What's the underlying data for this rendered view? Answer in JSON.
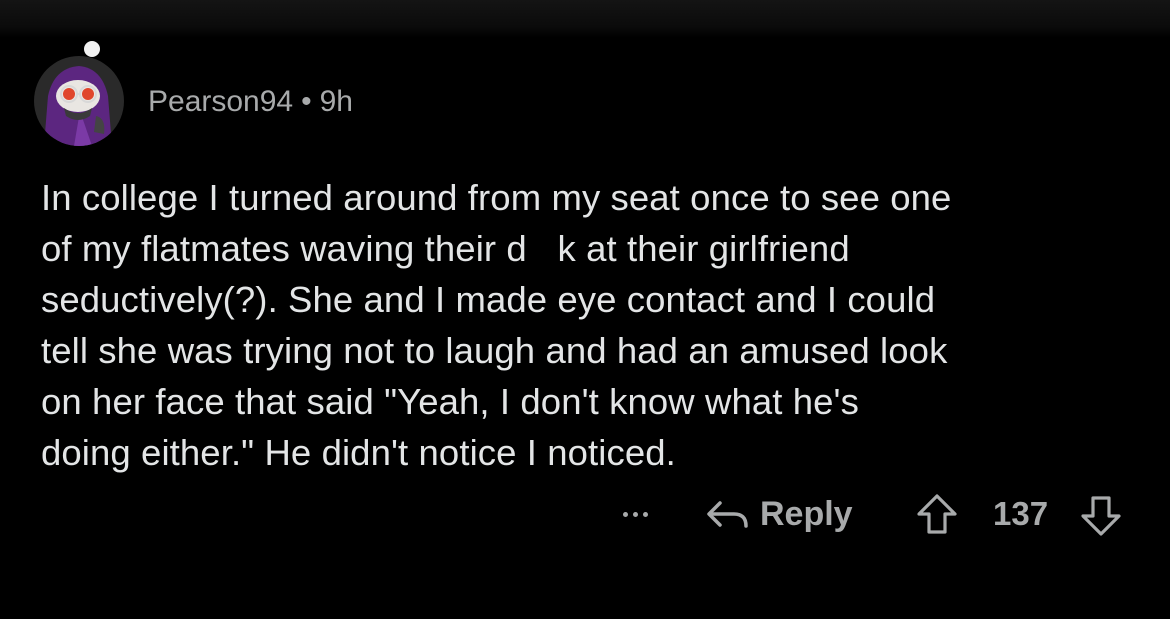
{
  "comment": {
    "author": "Pearson94",
    "separator": "•",
    "age": "9h",
    "body_lines": [
      "In college I turned around from my seat once to see one",
      "of my flatmates waving their d   k at their girlfriend",
      "seductively(?). She and I made eye contact and I could",
      "tell she was trying not to laugh and had an amused look",
      "on her face that said \"Yeah, I don't know what he's",
      "doing either.\" He didn't notice I noticed."
    ]
  },
  "actions": {
    "more_icon": "ellipsis-icon",
    "reply_icon": "reply-arrow-icon",
    "reply_label": "Reply",
    "upvote_icon": "upvote-arrow-icon",
    "score": "137",
    "downvote_icon": "downvote-arrow-icon"
  },
  "colors": {
    "background": "#000000",
    "body_text": "#e3e5e6",
    "meta_text": "#a8aaab",
    "avatar_purple": "#6a2a8c",
    "avatar_accent": "#e0462c"
  }
}
